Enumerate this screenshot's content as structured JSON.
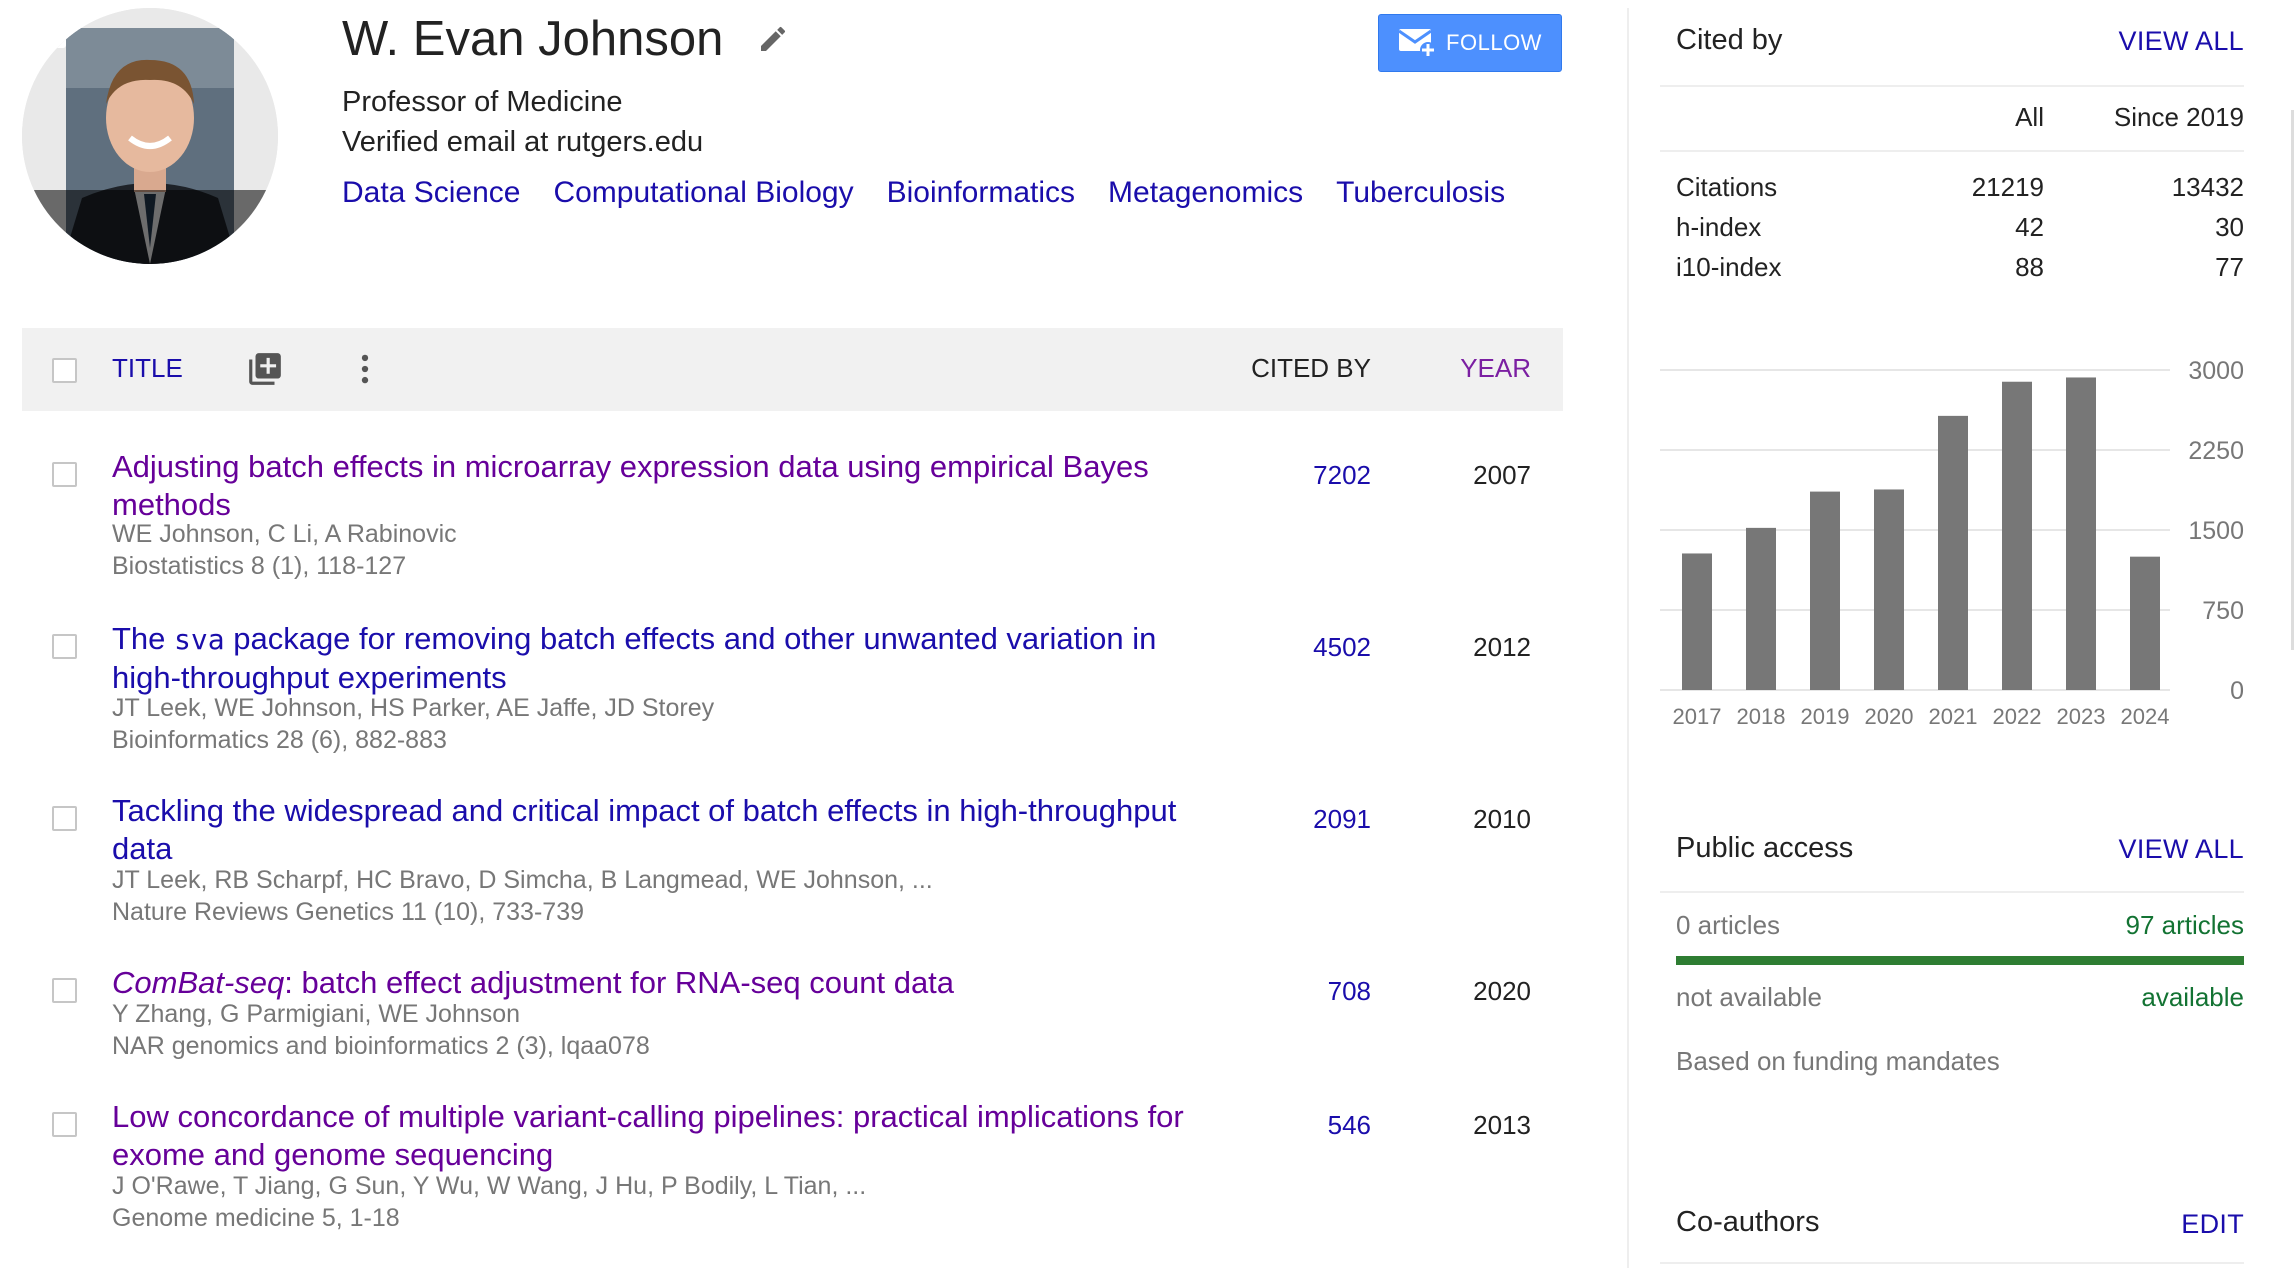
{
  "profile": {
    "name": "W. Evan Johnson",
    "affiliation": "Professor of Medicine",
    "email": "Verified email at rutgers.edu",
    "interests": [
      "Data Science",
      "Computational Biology",
      "Bioinformatics",
      "Metagenomics",
      "Tuberculosis"
    ],
    "follow_label": "FOLLOW",
    "icons": {
      "edit": "pencil-icon",
      "photo": "add-photo-icon",
      "follow": "mail-add-icon"
    }
  },
  "table_header": {
    "title_label": "TITLE",
    "cited_by_label": "CITED BY",
    "year_label": "YEAR",
    "icons": {
      "add": "add-to-library-icon",
      "more": "more-vert-icon"
    }
  },
  "articles": [
    {
      "title": "Adjusting batch effects in microarray expression data using empirical Bayes methods",
      "authors": "WE Johnson, C Li, A Rabinovic",
      "venue": "Biostatistics 8 (1), 118-127",
      "cited_by": "7202",
      "year": "2007"
    },
    {
      "title_pre": "The ",
      "title_code": "sva",
      "title_post": " package for removing batch effects and other unwanted variation in high-throughput experiments",
      "authors": "JT Leek, WE Johnson, HS Parker, AE Jaffe, JD Storey",
      "venue": "Bioinformatics 28 (6), 882-883",
      "cited_by": "4502",
      "year": "2012"
    },
    {
      "title": "Tackling the widespread and critical impact of batch effects in high-throughput data",
      "authors": "JT Leek, RB Scharpf, HC Bravo, D Simcha, B Langmead, WE Johnson, ...",
      "venue": "Nature Reviews Genetics 11 (10), 733-739",
      "cited_by": "2091",
      "year": "2010"
    },
    {
      "title_em": "ComBat-seq",
      "title_post": ": batch effect adjustment for RNA-seq count data",
      "authors": "Y Zhang, G Parmigiani, WE Johnson",
      "venue": "NAR genomics and bioinformatics 2 (3), lqaa078",
      "cited_by": "708",
      "year": "2020"
    },
    {
      "title": "Low concordance of multiple variant-calling pipelines: practical implications for exome and genome sequencing",
      "authors": "J O'Rawe, T Jiang, G Sun, Y Wu, W Wang, J Hu, P Bodily, L Tian, ...",
      "venue": "Genome medicine 5, 1-18",
      "cited_by": "546",
      "year": "2013"
    }
  ],
  "cited_by": {
    "heading": "Cited by",
    "view_all": "VIEW ALL",
    "col_all": "All",
    "col_since": "Since 2019",
    "rows": [
      {
        "label": "Citations",
        "all": "21219",
        "since": "13432"
      },
      {
        "label": "h-index",
        "all": "42",
        "since": "30"
      },
      {
        "label": "i10-index",
        "all": "88",
        "since": "77"
      }
    ]
  },
  "chart_data": {
    "type": "bar",
    "categories": [
      "2017",
      "2018",
      "2019",
      "2020",
      "2021",
      "2022",
      "2023",
      "2024"
    ],
    "values": [
      1280,
      1520,
      1860,
      1880,
      2570,
      2890,
      2930,
      1250
    ],
    "y_ticks": [
      "0",
      "750",
      "1500",
      "2250",
      "3000"
    ],
    "ylim": [
      0,
      3000
    ],
    "grid": true,
    "bar_color": "#777777"
  },
  "public_access": {
    "heading": "Public access",
    "view_all": "VIEW ALL",
    "unavailable_count": "0 articles",
    "available_count": "97 articles",
    "available_fraction": 1.0,
    "not_available_label": "not available",
    "available_label": "available",
    "note": "Based on funding mandates"
  },
  "coauthors": {
    "heading": "Co-authors",
    "edit": "EDIT"
  }
}
